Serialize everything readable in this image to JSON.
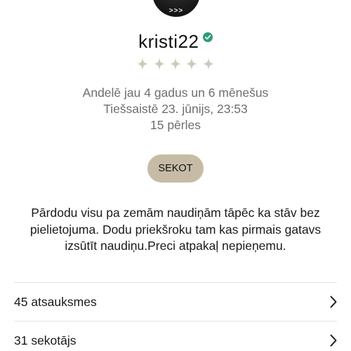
{
  "profile": {
    "avatar_text": ">>>",
    "username": "kristi22",
    "verified": true,
    "rating_stars": 5,
    "member_since": "Andelē jau 4 gadus un 6 mēnešus",
    "last_online": "Tiešsaistē 23. jūnijs, 23:53",
    "pearls": "15 pērles",
    "follow_label": "SEKOT",
    "bio_lines": [
      "Pārdodu visu pa zemām naudiņām tāpēc ka stāv bez",
      "pielietojuma. Dodu priekšroku tam kas pirmais gatavs",
      "izsūtīt naudiņu.Preci atpakaļ nepieņemu."
    ]
  },
  "links": [
    {
      "label": "45 atsauksmes"
    },
    {
      "label": "31 sekotājs"
    }
  ],
  "colors": {
    "accent": "#c6bca6",
    "star": "#cfc8b8",
    "verified": "#2e9c74",
    "muted_text": "#6e6e6e",
    "divider": "#e4e4e4"
  },
  "icons": {
    "verified": "verified-badge-icon",
    "rating": "star-icon",
    "row_arrow": "chevron-right-icon"
  }
}
